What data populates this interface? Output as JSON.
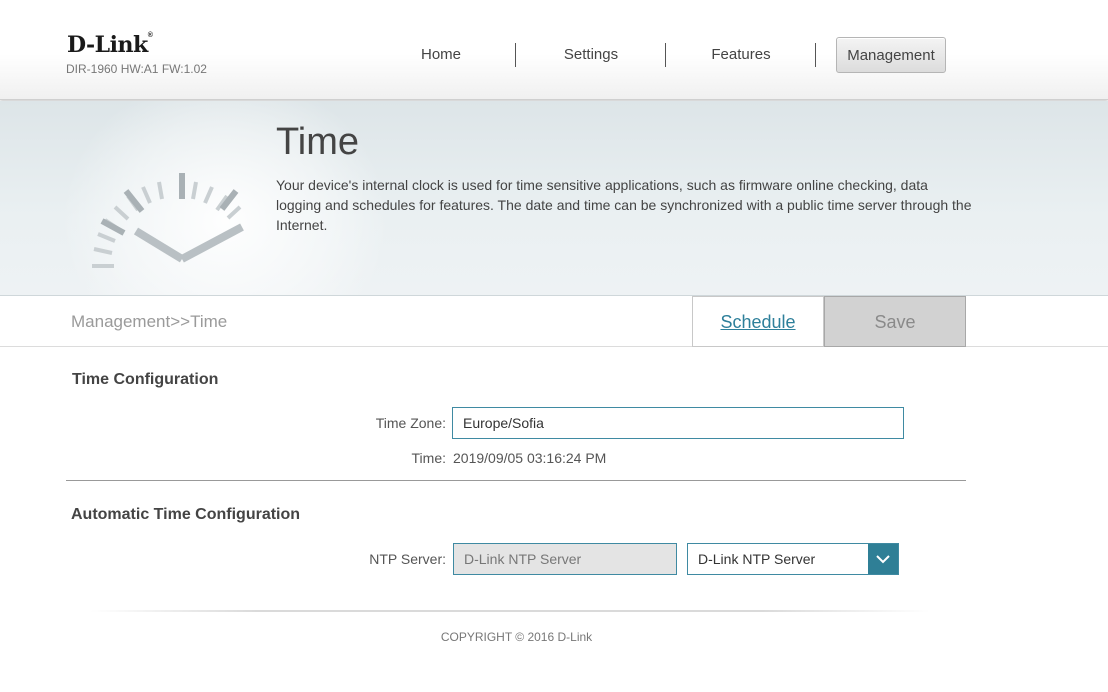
{
  "header": {
    "logo": "D-Link",
    "model_info": "DIR-1960 HW:A1 FW:1.02",
    "nav": [
      {
        "label": "Home",
        "active": false
      },
      {
        "label": "Settings",
        "active": false
      },
      {
        "label": "Features",
        "active": false
      },
      {
        "label": "Management",
        "active": true
      }
    ]
  },
  "banner": {
    "icon": "clock-icon",
    "title": "Time",
    "description": "Your device's internal clock is used for time sensitive applications, such as firmware online checking, data logging and schedules for features. The date and time can be synchronized with a public time server through the Internet."
  },
  "toolbar": {
    "breadcrumb": "Management>>Time",
    "schedule_label": "Schedule",
    "save_label": "Save"
  },
  "time_config": {
    "section_title": "Time Configuration",
    "timezone_label": "Time Zone:",
    "timezone_value": "Europe/Sofia",
    "time_label": "Time:",
    "time_value": "2019/09/05 03:16:24 PM"
  },
  "auto_time": {
    "section_title": "Automatic Time Configuration",
    "ntp_label": "NTP Server:",
    "ntp_input_value": "D-Link NTP Server",
    "ntp_select_value": "D-Link NTP Server"
  },
  "footer": {
    "copyright": "COPYRIGHT © 2016 D-Link"
  },
  "colors": {
    "accent": "#2f7f96",
    "link": "#2d7f9a",
    "banner_bg": "#e6edf0"
  }
}
